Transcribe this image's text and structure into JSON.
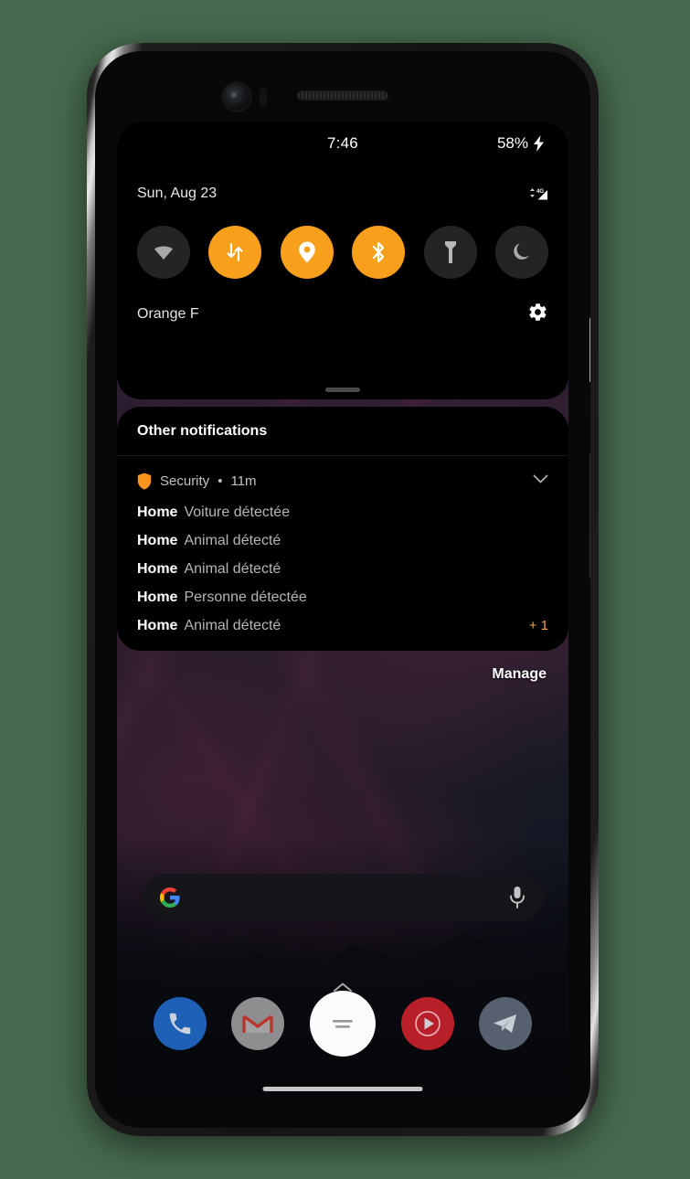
{
  "theme": {
    "page_background": "#476b4e",
    "accent_orange": "#f8a01c",
    "tile_off": "#242424",
    "panel_background": "#000000"
  },
  "status_bar": {
    "time": "7:46",
    "battery_percent": "58%",
    "charging_icon": "bolt-icon",
    "signal_icon": "signal-4g-icon"
  },
  "quick_settings": {
    "date": "Sun, Aug 23",
    "carrier": "Orange F",
    "settings_icon": "gear-icon",
    "drag_handle": "panel-drag-handle",
    "tiles": [
      {
        "name": "wifi",
        "icon": "wifi-icon",
        "state": "off"
      },
      {
        "name": "mobile-data",
        "icon": "mobile-data-icon",
        "state": "on"
      },
      {
        "name": "location",
        "icon": "location-pin-icon",
        "state": "on"
      },
      {
        "name": "bluetooth",
        "icon": "bluetooth-icon",
        "state": "on"
      },
      {
        "name": "flashlight",
        "icon": "flashlight-icon",
        "state": "off"
      },
      {
        "name": "dark-theme",
        "icon": "moon-icon",
        "state": "off"
      }
    ]
  },
  "notifications": {
    "section_header": "Other notifications",
    "app_name": "Security",
    "separator": "•",
    "time_ago": "11m",
    "app_icon": "shield-icon",
    "expand_icon": "chevron-down-icon",
    "more_count": "+ 1",
    "items": [
      {
        "title": "Home",
        "text": "Voiture détectée"
      },
      {
        "title": "Home",
        "text": "Animal détecté"
      },
      {
        "title": "Home",
        "text": "Animal détecté"
      },
      {
        "title": "Home",
        "text": "Personne détectée"
      },
      {
        "title": "Home",
        "text": "Animal détecté"
      }
    ],
    "manage_label": "Manage"
  },
  "search": {
    "placeholder": "",
    "value": "",
    "logo_icon": "google-g-icon",
    "mic_icon": "microphone-icon"
  },
  "home": {
    "drawer_chevron_icon": "chevron-up-icon",
    "nav_pill": "gesture-nav-pill",
    "dock": [
      {
        "name": "phone",
        "icon": "phone-icon"
      },
      {
        "name": "gmail",
        "icon": "gmail-icon"
      },
      {
        "name": "notes",
        "icon": "notes-icon"
      },
      {
        "name": "youtube",
        "icon": "youtube-icon"
      },
      {
        "name": "telegram",
        "icon": "telegram-icon"
      }
    ]
  },
  "device": {
    "camera": "front-camera",
    "earpiece": "earpiece-speaker",
    "power_button": "power-button",
    "volume_button": "volume-rocker"
  }
}
